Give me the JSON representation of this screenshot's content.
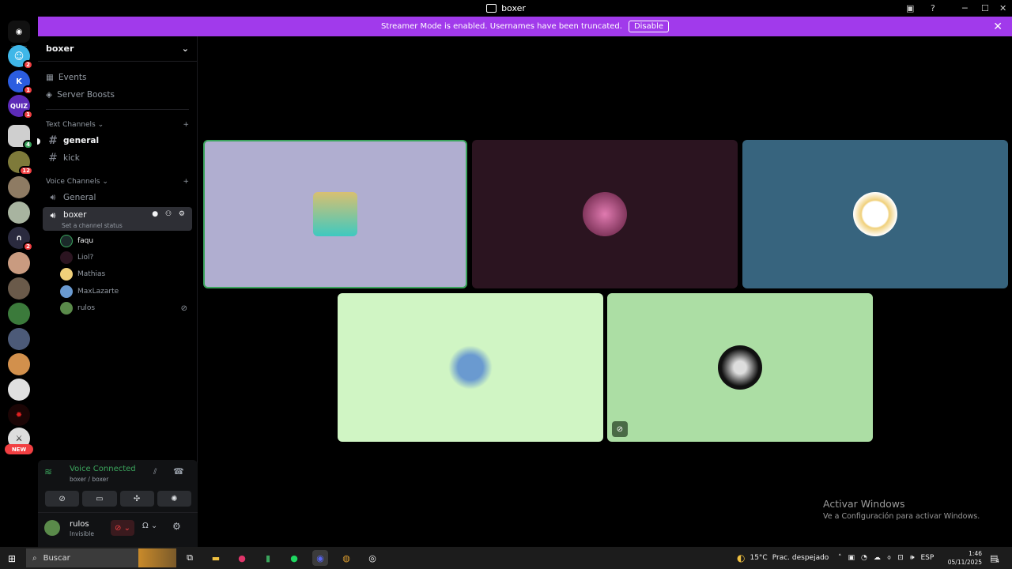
{
  "window": {
    "title": "boxer"
  },
  "banner": {
    "text": "Streamer Mode is enabled. Usernames have been truncated.",
    "button": "Disable"
  },
  "server": {
    "name": "boxer"
  },
  "menu": {
    "events": "Events",
    "boosts": "Server Boosts"
  },
  "text_category": "Text Channels",
  "text_channels": [
    {
      "name": "general"
    },
    {
      "name": "kick"
    }
  ],
  "voice_category": "Voice Channels",
  "voice_channels": [
    {
      "name": "General"
    },
    {
      "name": "boxer",
      "status": "Set a channel status"
    }
  ],
  "voice_users": [
    {
      "name": "faqu"
    },
    {
      "name": "Liol?"
    },
    {
      "name": "Mathias"
    },
    {
      "name": "MaxLazarte"
    },
    {
      "name": "rulos"
    }
  ],
  "rail_badges": [
    "2",
    "1",
    "1",
    "4",
    "12",
    "2"
  ],
  "rail_new": "NEW",
  "voice_panel": {
    "status": "Voice Connected",
    "location": "boxer / boxer"
  },
  "user": {
    "name": "rulos",
    "status": "Invisible"
  },
  "watermark": {
    "title": "Activar Windows",
    "subtitle": "Ve a Configuración para activar Windows."
  },
  "taskbar": {
    "search": "Buscar",
    "weather_temp": "15°C",
    "weather_desc": "Prac. despejado",
    "lang": "ESP",
    "time": "1:46",
    "date": "05/11/2025",
    "notif": "4"
  },
  "colors": {
    "banner": "#a13aeb",
    "tile1": "#b0aed0",
    "tile2": "#2b1420",
    "tile3": "#37647e",
    "tile4": "#d0f5c4",
    "tile5": "#acdea4",
    "speaking": "#3ba55d"
  }
}
